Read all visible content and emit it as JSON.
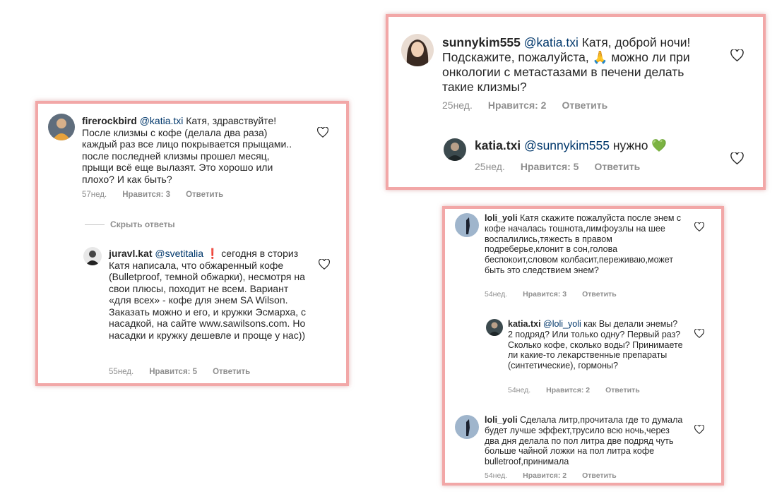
{
  "left_card": {
    "comment1": {
      "username": "firerockbird",
      "mention": "@katia.txi",
      "text": "Катя, здравствуйте! После клизмы с кофе (делала два раза) каждый раз все лицо покрывается прыщами.. после последней клизмы прошел месяц, прыщи всё еще вылазят. Это хорошо или плохо? И как быть?",
      "time": "57нед.",
      "likes": "Нравится: 3",
      "reply": "Ответить"
    },
    "hide_replies": "Скрыть ответы",
    "comment2": {
      "username": "juravl.kat",
      "mention": "@svetitalia",
      "emoji": "❗",
      "text": "сегодня в сториз Катя написала, что обжаренный кофе (Bulletproof, темной обжарки), несмотря на свои плюсы, походит не всем. Вариант «для всех» - кофе для энем SA Wilson. Заказать можно и его, и кружки Эсмарха, с насадкой, на сайте www.sawilsons.com. Но насадки и кружку дешевле и проще у нас))",
      "time": "55нед.",
      "likes": "Нравится: 5",
      "reply": "Ответить"
    }
  },
  "top_right_card": {
    "comment1": {
      "username": "sunnykim555",
      "mention": "@katia.txi",
      "text_before": "Катя, доброй ночи! Подскажите, пожалуйста,",
      "emoji": "🙏",
      "text_after": "можно ли при онкологии с метастазами в печени делать такие клизмы?",
      "time": "25нед.",
      "likes": "Нравится: 2",
      "reply": "Ответить"
    },
    "comment2": {
      "username": "katia.txi",
      "mention": "@sunnykim555",
      "text": "нужно",
      "emoji": "💚",
      "time": "25нед.",
      "likes": "Нравится: 5",
      "reply": "Ответить"
    }
  },
  "bottom_right_card": {
    "comment1": {
      "username": "loli_yoli",
      "text": "Катя скажите пожалуйста после энем с кофе началась тошнота,лимфоузлы на шее воспалились,тяжесть в правом подреберье,клонит в сон,голова беспокоит,словом колбасит,переживаю,может быть это следствием энем?",
      "time": "54нед.",
      "likes": "Нравится: 3",
      "reply": "Ответить"
    },
    "comment2": {
      "username": "katia.txi",
      "mention": "@loli_yoli",
      "text": "как Вы делали энемы? 2 подряд? Или только одну? Первый раз? Сколько кофе, сколько воды? Принимаете ли какие-то лекарственные препараты (синтетические), гормоны?",
      "time": "54нед.",
      "likes": "Нравится: 2",
      "reply": "Ответить"
    },
    "comment3": {
      "username": "loli_yoli",
      "text": "Сделала литр,прочитала где то думала будет лучше эффект,трусило всю ночь,через два дня делала по пол литра две подряд чуть больше чайной ложки на пол литра кофе bulletroof,принимала",
      "time": "54нед.",
      "likes": "Нравится: 2",
      "reply": "Ответить"
    }
  },
  "icons": {
    "heart": "heart-outline-icon",
    "avatar": "user-avatar"
  },
  "colors": {
    "frame": "#f2a7a7",
    "mention": "#00376b",
    "meta": "#8e8e8e"
  }
}
